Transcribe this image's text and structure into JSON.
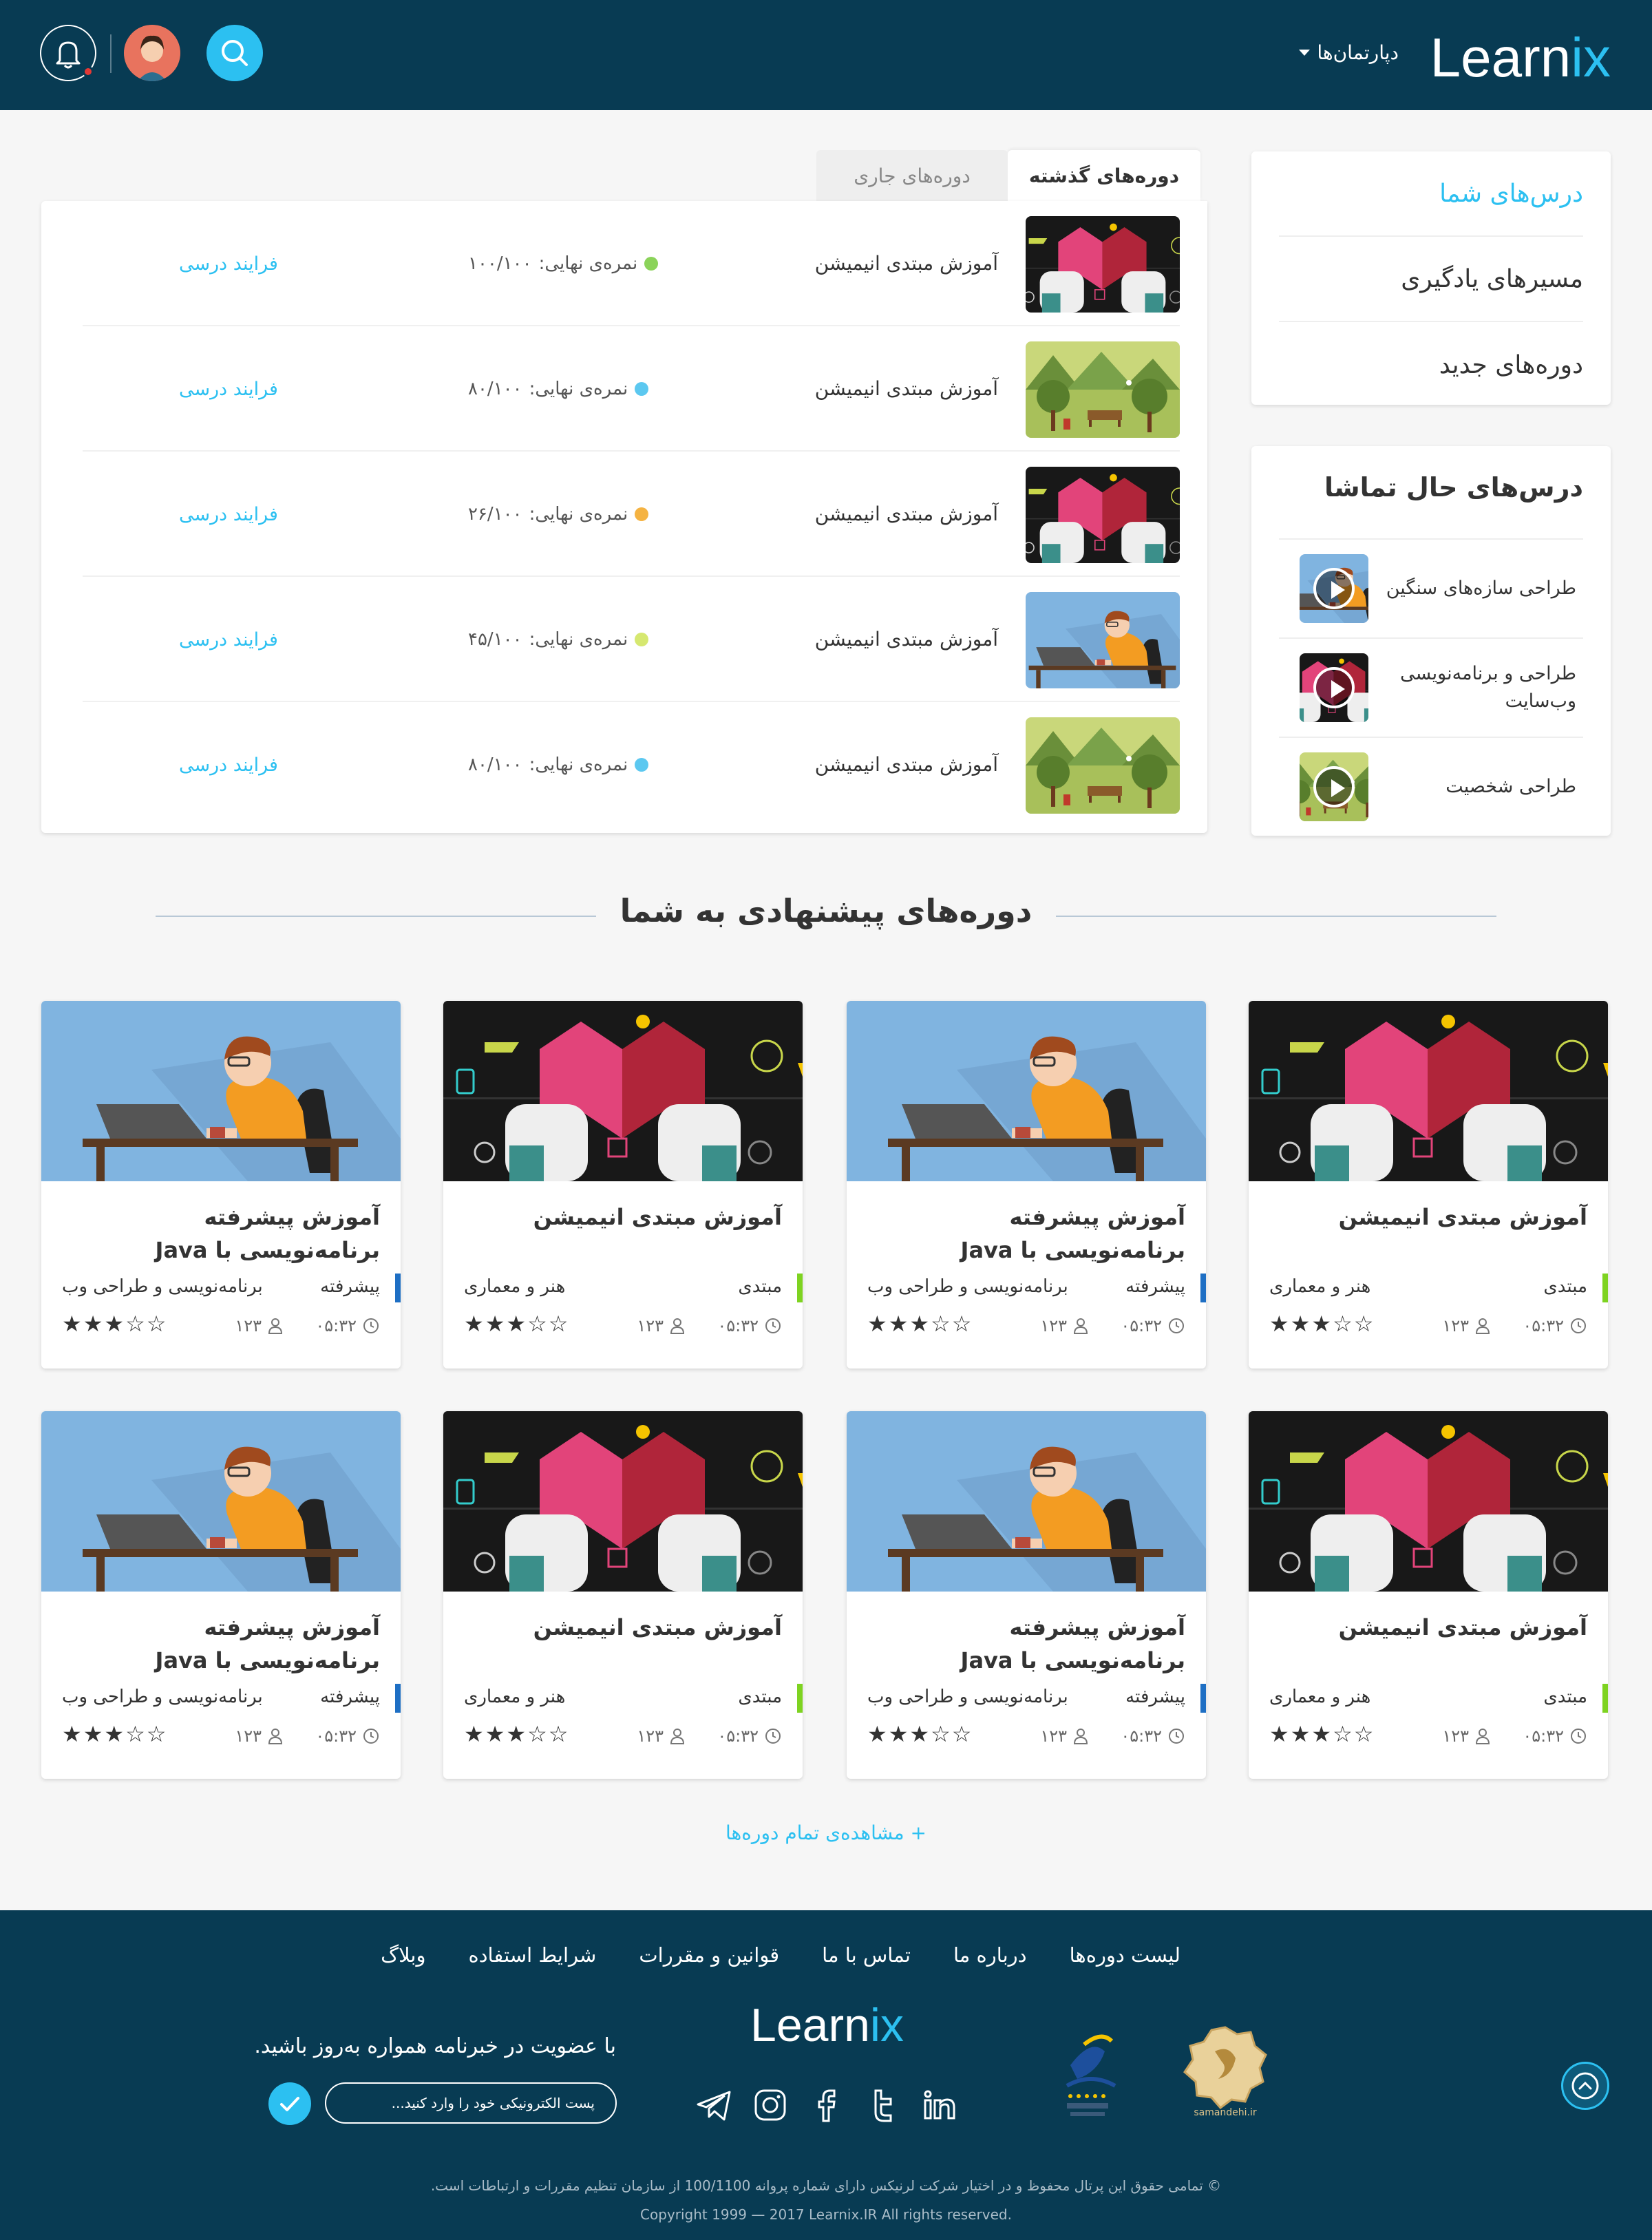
{
  "header": {
    "logo_main": "Learn",
    "logo_accent": "ix",
    "departments_label": "دپارتمان‌ها"
  },
  "sidebar_menu": {
    "items": [
      {
        "label": "درس‌های شما",
        "active": true
      },
      {
        "label": "مسیرهای یادگیری",
        "active": false
      },
      {
        "label": "دوره‌های جدید",
        "active": false
      }
    ]
  },
  "watching": {
    "title": "درس‌های حال تماشا",
    "items": [
      {
        "title": "طراحی سازه‌های سنگین",
        "thumb": "coder"
      },
      {
        "title": "طراحی و برنامه‌نویسی وب‌سایت",
        "thumb": "anim"
      },
      {
        "title": "طراحی شخصیت",
        "thumb": "park"
      }
    ]
  },
  "tabs": {
    "current": "دوره‌های جاری",
    "past": "دوره‌های گذشته"
  },
  "past_courses": [
    {
      "title": "آموزش مبتدی انیمیشن",
      "score_label": "نمره‌ی نهایی:",
      "score": "۱۰۰/۱۰۰",
      "dot": "#8bd35a",
      "link": "فرایند درسی",
      "thumb": "anim"
    },
    {
      "title": "آموزش مبتدی انیمیشن",
      "score_label": "نمره‌ی نهایی:",
      "score": "۸۰/۱۰۰",
      "dot": "#5cc8f0",
      "link": "فرایند درسی",
      "thumb": "park"
    },
    {
      "title": "آموزش مبتدی انیمیشن",
      "score_label": "نمره‌ی نهایی:",
      "score": "۲۶/۱۰۰",
      "dot": "#f5b342",
      "link": "فرایند درسی",
      "thumb": "anim"
    },
    {
      "title": "آموزش مبتدی انیمیشن",
      "score_label": "نمره‌ی نهایی:",
      "score": "۴۵/۱۰۰",
      "dot": "#d6e870",
      "link": "فرایند درسی",
      "thumb": "coder"
    },
    {
      "title": "آموزش مبتدی انیمیشن",
      "score_label": "نمره‌ی نهایی:",
      "score": "۸۰/۱۰۰",
      "dot": "#5cc8f0",
      "link": "فرایند درسی",
      "thumb": "park"
    }
  ],
  "recommended": {
    "title": "دوره‌های پیشنهادی به شما",
    "courses": [
      {
        "title": "آموزش مبتدی انیمیشن",
        "level": "مبتدی",
        "bar": "#7ed321",
        "category": "هنر و معماری",
        "users": "۱۲۳",
        "time": "۰۵:۳۲",
        "stars": 3,
        "image": "anim"
      },
      {
        "title": "آموزش پیشرفته برنامه‌نویسی با Java",
        "level": "پیشرفته",
        "bar": "#1e6fc4",
        "category": "برنامه‌نویسی و طراحی وب",
        "users": "۱۲۳",
        "time": "۰۵:۳۲",
        "stars": 3,
        "image": "coder"
      },
      {
        "title": "آموزش مبتدی انیمیشن",
        "level": "مبتدی",
        "bar": "#7ed321",
        "category": "هنر و معماری",
        "users": "۱۲۳",
        "time": "۰۵:۳۲",
        "stars": 3,
        "image": "anim"
      },
      {
        "title": "آموزش پیشرفته برنامه‌نویسی با Java",
        "level": "پیشرفته",
        "bar": "#1e6fc4",
        "category": "برنامه‌نویسی و طراحی وب",
        "users": "۱۲۳",
        "time": "۰۵:۳۲",
        "stars": 3,
        "image": "coder"
      },
      {
        "title": "آموزش مبتدی انیمیشن",
        "level": "مبتدی",
        "bar": "#7ed321",
        "category": "هنر و معماری",
        "users": "۱۲۳",
        "time": "۰۵:۳۲",
        "stars": 3,
        "image": "anim"
      },
      {
        "title": "آموزش پیشرفته برنامه‌نویسی با Java",
        "level": "پیشرفته",
        "bar": "#1e6fc4",
        "category": "برنامه‌نویسی و طراحی وب",
        "users": "۱۲۳",
        "time": "۰۵:۳۲",
        "stars": 3,
        "image": "coder"
      },
      {
        "title": "آموزش مبتدی انیمیشن",
        "level": "مبتدی",
        "bar": "#7ed321",
        "category": "هنر و معماری",
        "users": "۱۲۳",
        "time": "۰۵:۳۲",
        "stars": 3,
        "image": "anim"
      },
      {
        "title": "آموزش پیشرفته برنامه‌نویسی با Java",
        "level": "پیشرفته",
        "bar": "#1e6fc4",
        "category": "برنامه‌نویسی و طراحی وب",
        "users": "۱۲۳",
        "time": "۰۵:۳۲",
        "stars": 3,
        "image": "coder"
      }
    ],
    "more_label": "+ مشاهده‌ی تمام دوره‌ها"
  },
  "footer": {
    "links": [
      "لیست دوره‌ها",
      "درباره ما",
      "تماس با ما",
      "قوانین و مقررات",
      "شرایط استفاده",
      "وبلاگ"
    ],
    "logo_main": "Learn",
    "logo_accent": "ix",
    "newsletter_text": "با عضویت در خبرنامه همواره به‌روز باشید.",
    "newsletter_placeholder": "پست الکترونیکی خود را وارد کنید...",
    "social": [
      "linkedin-icon",
      "twitter-icon",
      "facebook-icon",
      "instagram-icon",
      "telegram-icon"
    ],
    "copyright_fa": "© تمامی حقوق این پرتال محفوظ و در اختیار شرکت لرنیکس دارای شماره پروانه 100/1100 از سازمان تنظیم مقررات و ارتباطات است.",
    "copyright_en": "Copyright 1999 — 2017 Learnix.IR All rights reserved.",
    "badges": {
      "samandehi": "samandehi.ir"
    }
  },
  "colors": {
    "header_bg": "#083b53",
    "accent": "#2cc0f1",
    "star": "#f5a623"
  }
}
